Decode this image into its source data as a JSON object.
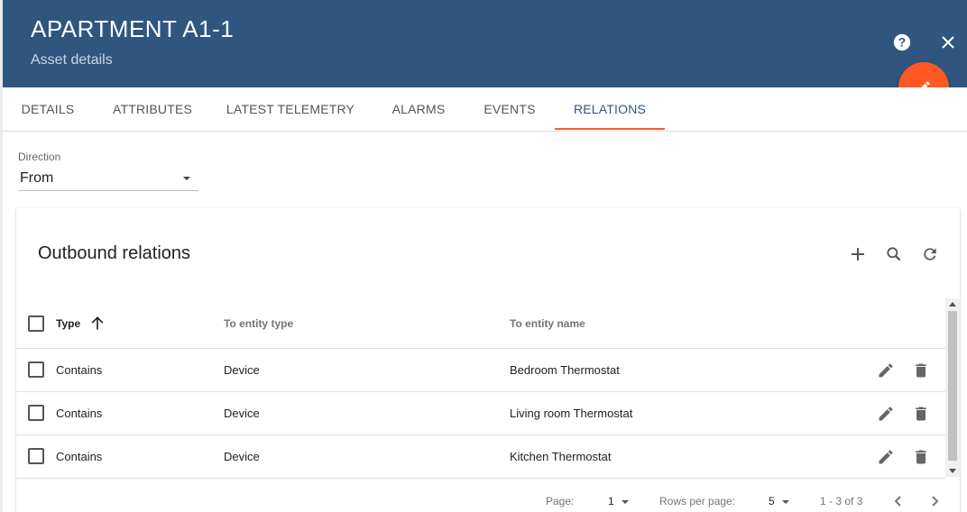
{
  "header": {
    "title": "APARTMENT A1-1",
    "subtitle": "Asset details",
    "help_icon": "help-circle-icon",
    "close_icon": "close-icon",
    "edit_icon": "pencil-icon",
    "bg_color": "#305680",
    "fab_color": "#ff5722"
  },
  "tabs": [
    {
      "label": "DETAILS"
    },
    {
      "label": "ATTRIBUTES"
    },
    {
      "label": "LATEST TELEMETRY"
    },
    {
      "label": "ALARMS"
    },
    {
      "label": "EVENTS"
    },
    {
      "label": "RELATIONS",
      "active": true
    }
  ],
  "direction": {
    "label": "Direction",
    "value": "From"
  },
  "relations": {
    "title": "Outbound relations",
    "actions": [
      "add-icon",
      "search-icon",
      "refresh-icon"
    ],
    "columns": {
      "type": "Type",
      "to_entity_type": "To entity type",
      "to_entity_name": "To entity name"
    },
    "sort": {
      "column": "Type",
      "direction": "ascending"
    },
    "rows": [
      {
        "type": "Contains",
        "entity_type": "Device",
        "entity_name": "Bedroom Thermostat"
      },
      {
        "type": "Contains",
        "entity_type": "Device",
        "entity_name": "Living room Thermostat"
      },
      {
        "type": "Contains",
        "entity_type": "Device",
        "entity_name": "Kitchen Thermostat"
      }
    ],
    "row_actions": [
      "edit-icon",
      "delete-icon"
    ]
  },
  "pagination": {
    "page_label": "Page:",
    "page": "1",
    "rows_label": "Rows per page:",
    "rows_per_page": "5",
    "range": "1 - 3 of 3"
  }
}
